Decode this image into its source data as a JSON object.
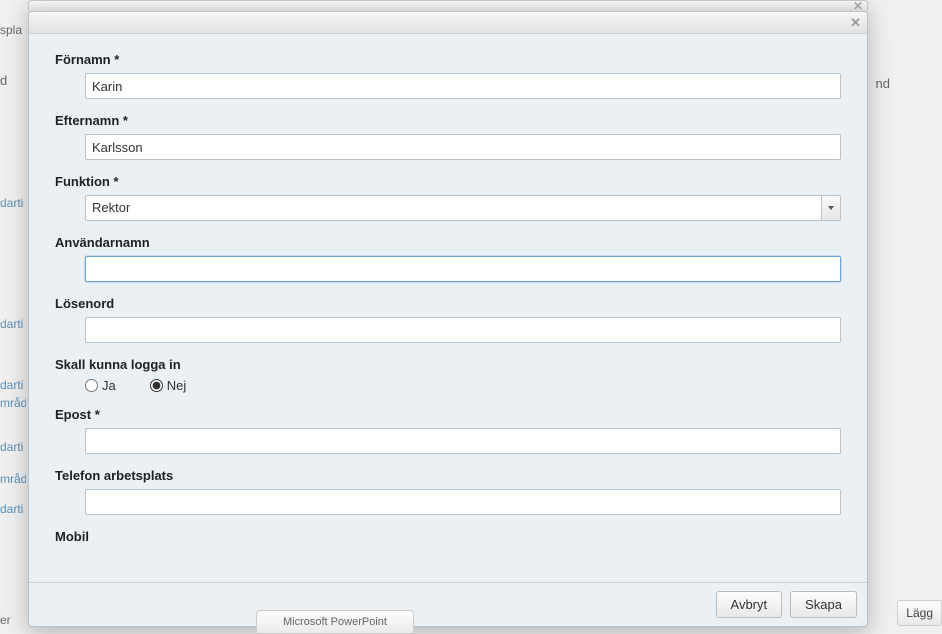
{
  "bg": {
    "spla": "spla",
    "d": "d",
    "nd": "nd",
    "er": "er",
    "dart_link": "darti",
    "mrad_link": "mråd",
    "lagg": "Lägg"
  },
  "form": {
    "fornamn": {
      "label": "Förnamn *",
      "value": "Karin"
    },
    "efternamn": {
      "label": "Efternamn *",
      "value": "Karlsson"
    },
    "funktion": {
      "label": "Funktion *",
      "value": "Rektor"
    },
    "anvandarnamn": {
      "label": "Användarnamn",
      "value": ""
    },
    "losenord": {
      "label": "Lösenord",
      "value": ""
    },
    "login": {
      "label": "Skall kunna logga in",
      "ja": "Ja",
      "nej": "Nej",
      "selected": "nej"
    },
    "epost": {
      "label": "Epost *",
      "value": ""
    },
    "telefon": {
      "label": "Telefon arbetsplats",
      "value": ""
    },
    "mobil": {
      "label": "Mobil",
      "value": ""
    }
  },
  "buttons": {
    "cancel": "Avbryt",
    "create": "Skapa"
  },
  "taskbar": {
    "app": "Microsoft PowerPoint"
  }
}
